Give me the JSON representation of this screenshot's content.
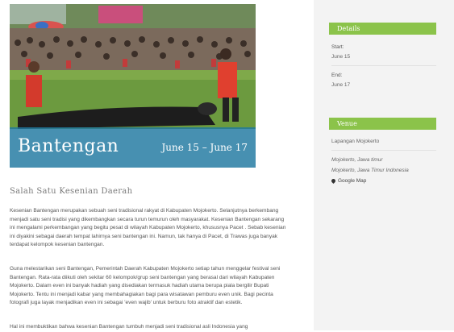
{
  "event": {
    "title": "Bantengan",
    "dates": "June 15 – June 17",
    "subtitle": "Salah Satu Kesenian Daerah",
    "paragraphs": [
      "Kesenian Bantengan merupakan sebuah seni tradisional rakyat di Kabupaten Mojokerto. Selanjutnya berkembang menjadi satu seni tradisi yang dikembangkan secara turun temurun oleh masyarakat. Kesenian Bantengan sekarang ini mengalami perkembangan yang begitu pesat di wilayah Kabupaten Mojokerto, khususnya Pacet . Sebab kesenian ini diyakini sebagai daerah tempat lahirnya seni bantengan ini. Namun, tak hanya di Pacet, di Trawas juga banyak terdapat kelompok kesenian bantengan.",
      "Guna melestarikan seni Bantengan, Pemerintah Daerah Kabupaten Mojokerto setiap tahun menggelar festival seni Bantengan. Rata-rata diikuti oleh sekitar 60 kelompok/grup seni bantengan yang berasal dari wilayah Kabupaten Mojokerto. Dalam even ini banyak hadiah yang disediakan termasuk hadiah utama berupa piala bergilir Bupati Mojokerto. Tentu ini menjadi kabar yang membahagiakan bagi para wisatawan pemburu even unik. Bagi pecinta fotografi juga layak menjadikan even ini sebagai 'even wajib' untuk berburu foto atraktif dan estetik.",
      "Hal ini membuktikan bahwa kesenian Bantengan tumbuh menjadi seni tradisional asli Indonesia yang"
    ]
  },
  "sidebar": {
    "details_heading": "Details",
    "start_label": "Start:",
    "start_value": "June 15",
    "end_label": "End:",
    "end_value": "June 17",
    "venue_heading": "Venue",
    "venue_name": "Lapangan Mojokerto",
    "venue_city": "Mojokerto, Jawa timur",
    "venue_region": "Mojokerto, Jawa Timur Indonesia",
    "map_link": "Google Map"
  },
  "colors": {
    "accent_green": "#8bc34a",
    "hero_band": "#1f78a0",
    "sidebar_bg": "#f3f3f3"
  }
}
